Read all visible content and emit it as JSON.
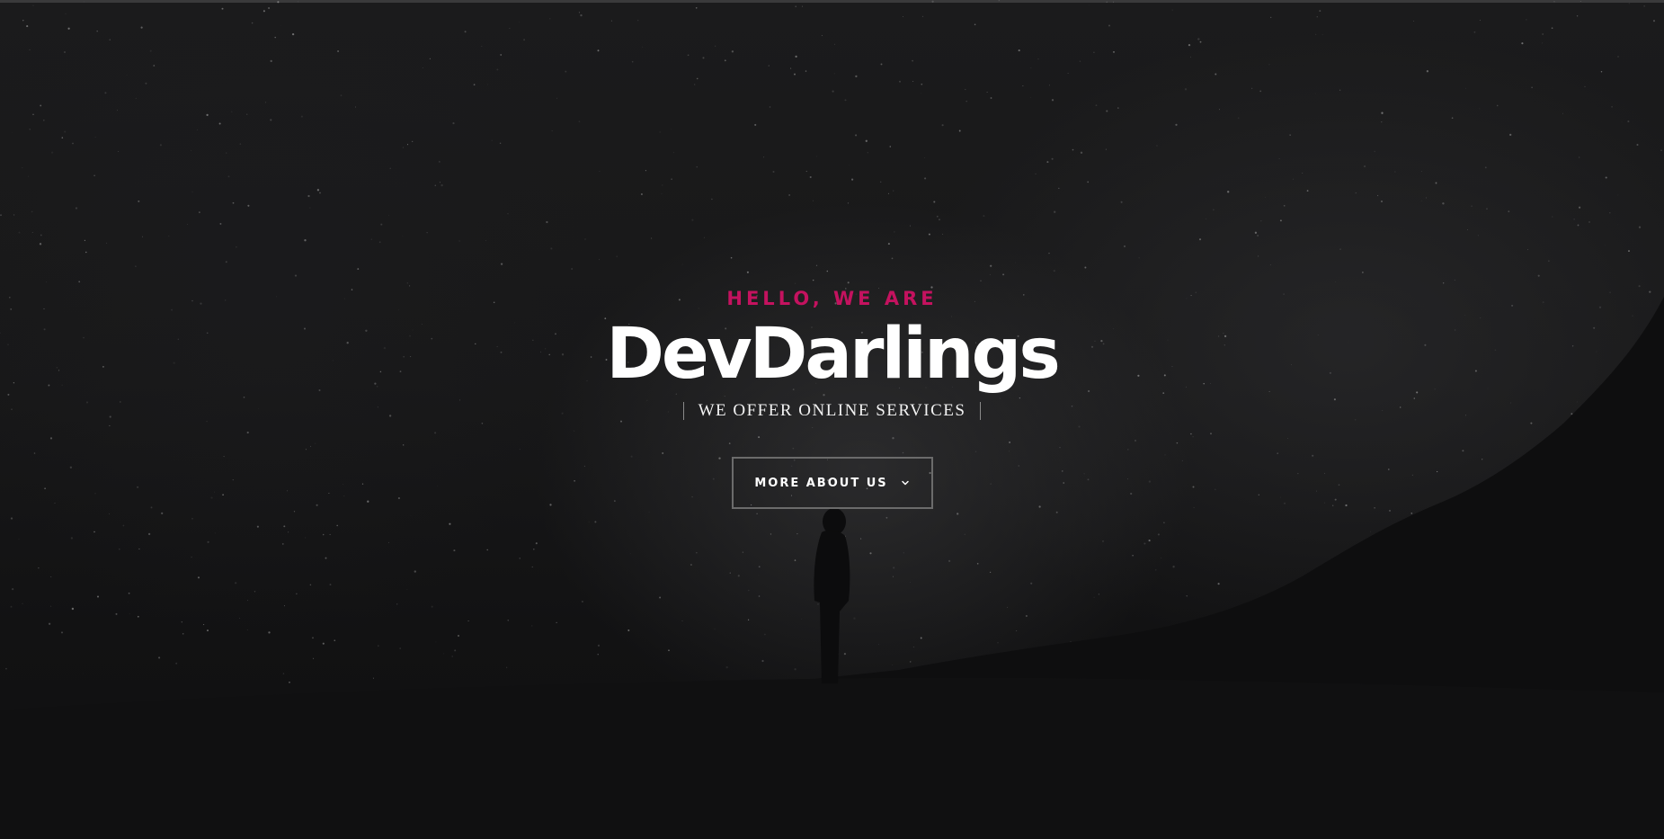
{
  "hero": {
    "eyebrow": "HELLO, WE ARE",
    "brand": "DevDarlings",
    "tagline": "WE OFFER ONLINE SERVICES",
    "cta_label": "MORE ABOUT US",
    "cta_icon": "chevron-down-icon"
  },
  "colors": {
    "accent": "#c4125f",
    "text": "#ffffff",
    "background": "#111112",
    "button_border": "#6b6b6b"
  }
}
